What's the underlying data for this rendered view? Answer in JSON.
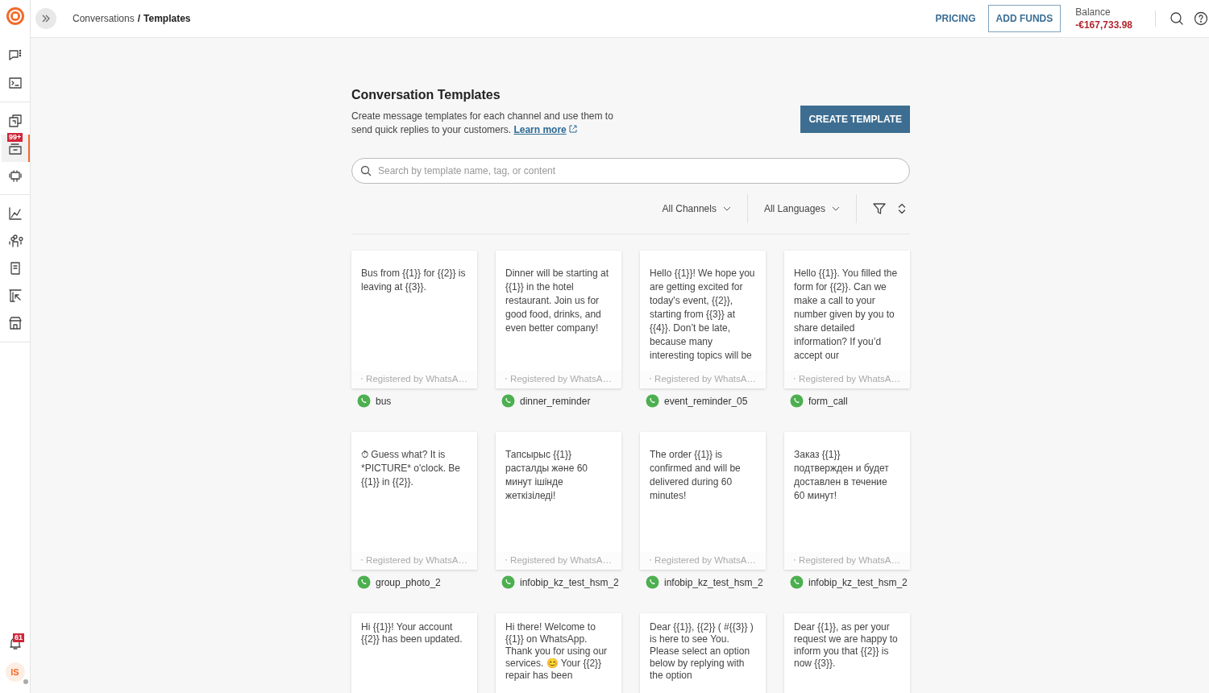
{
  "header": {
    "breadcrumb_parent": "Conversations",
    "breadcrumb_separator": "/",
    "breadcrumb_current": "Templates",
    "pricing": "PRICING",
    "add_funds": "ADD FUNDS",
    "balance_label": "Balance",
    "balance_value": "-€167,733.98"
  },
  "sidebar": {
    "groups": [
      {
        "items": [
          {
            "kind": "chat",
            "selected": false
          },
          {
            "kind": "terminal",
            "selected": false
          }
        ]
      },
      {
        "items": [
          {
            "kind": "copy",
            "selected": false
          },
          {
            "kind": "inbox",
            "selected": true,
            "badge": "99+"
          },
          {
            "kind": "bot",
            "selected": false
          }
        ]
      },
      {
        "items": [
          {
            "kind": "chart",
            "selected": false
          },
          {
            "kind": "people",
            "selected": false
          },
          {
            "kind": "book",
            "selected": false
          },
          {
            "kind": "board",
            "selected": false
          },
          {
            "kind": "store",
            "selected": false
          }
        ]
      }
    ],
    "notifications_badge": "61",
    "avatar": "IS"
  },
  "page": {
    "title": "Conversation Templates",
    "description": "Create message templates for each channel and use them to send quick replies to your customers.",
    "learn_more": "Learn more",
    "create_button": "CREATE TEMPLATE"
  },
  "search": {
    "placeholder": "Search by template name, tag, or content"
  },
  "filters": {
    "channels": "All Channels",
    "languages": "All Languages"
  },
  "templates": [
    {
      "text": "Bus from {{1}} for {{2}} is leaving at {{3}}.",
      "footer": "Registered by WhatsA…",
      "name": "bus"
    },
    {
      "text": "Dinner will be starting at {{1}} in the hotel restaurant. Join us for good food, drinks, and even better company!",
      "footer": "Registered by WhatsA…",
      "name": "dinner_reminder"
    },
    {
      "text": "Hello {{1}}! We hope you are getting excited for today's event, {{2}}, starting from {{3}} at {{4}}. Don’t be late, because many interesting topics will be",
      "footer": "Registered by WhatsA…",
      "name": "event_reminder_05"
    },
    {
      "text": "Hello {{1}}. You filled the form for {{2}}. Can we make a call to your number given by you to share detailed information? If you’d accept our",
      "footer": "Registered by WhatsA…",
      "name": "form_call"
    },
    {
      "text": "⏱ Guess what? It is *PICTURE* o'clock. Be {{1}} in {{2}}.",
      "footer": "Registered by WhatsA…",
      "name": "group_photo_2"
    },
    {
      "text": "Тапсырыс {{1}} расталды және 60 минут ішінде жеткізіледі!",
      "footer": "Registered by WhatsA…",
      "name": "infobip_kz_test_hsm_2"
    },
    {
      "text": "The order {{1}} is confirmed and will be delivered during 60 minutes!",
      "footer": "Registered by WhatsA…",
      "name": "infobip_kz_test_hsm_2"
    },
    {
      "text": "Заказ {{1}} подтвержден и будет доставлен в течение 60 минут!",
      "footer": "Registered by WhatsA…",
      "name": "infobip_kz_test_hsm_2"
    },
    {
      "text": "Hi {{1}}! Your account {{2}} has been updated."
    },
    {
      "text": "Hi there! Welcome to {{1}} on WhatsApp. Thank you for using our services. 😊 Your {{2}} repair has been"
    },
    {
      "text": "Dear {{1}}, {{2}} ( #{{3}} ) is here to see You. Please select an option below by replying with the option"
    },
    {
      "text": "Dear {{1}}, as per your request we are happy to inform you that {{2}} is now {{3}}."
    }
  ]
}
